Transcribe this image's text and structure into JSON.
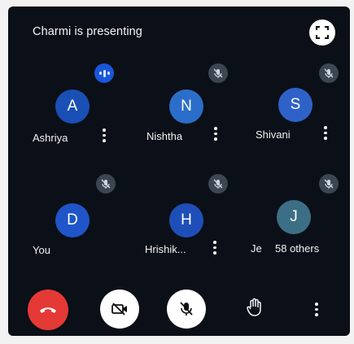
{
  "header": {
    "presenting_text": "Charmi is presenting",
    "fullscreen_icon": "fullscreen-icon"
  },
  "participants": [
    {
      "initial": "A",
      "name": "Ashriya",
      "avatar_color": "#1a4fb6",
      "status": "speaking"
    },
    {
      "initial": "N",
      "name": "Nishtha",
      "avatar_color": "#2b6ec9",
      "status": "muted"
    },
    {
      "initial": "S",
      "name": "Shivani",
      "avatar_color": "#2f62c8",
      "status": "muted"
    },
    {
      "initial": "D",
      "name": "You",
      "avatar_color": "#1f55c8",
      "status": "muted"
    },
    {
      "initial": "H",
      "name": "Hrishik...",
      "avatar_color": "#1e4fb8",
      "status": "muted"
    },
    {
      "initial": "J",
      "name": "Je",
      "avatar_color": "#3c6f86",
      "status": "muted",
      "others": "58 others"
    }
  ],
  "controls": {
    "end_call_color": "#e53935",
    "buttons": [
      "end-call",
      "camera-off",
      "mic-off",
      "raise-hand",
      "more-options"
    ]
  }
}
